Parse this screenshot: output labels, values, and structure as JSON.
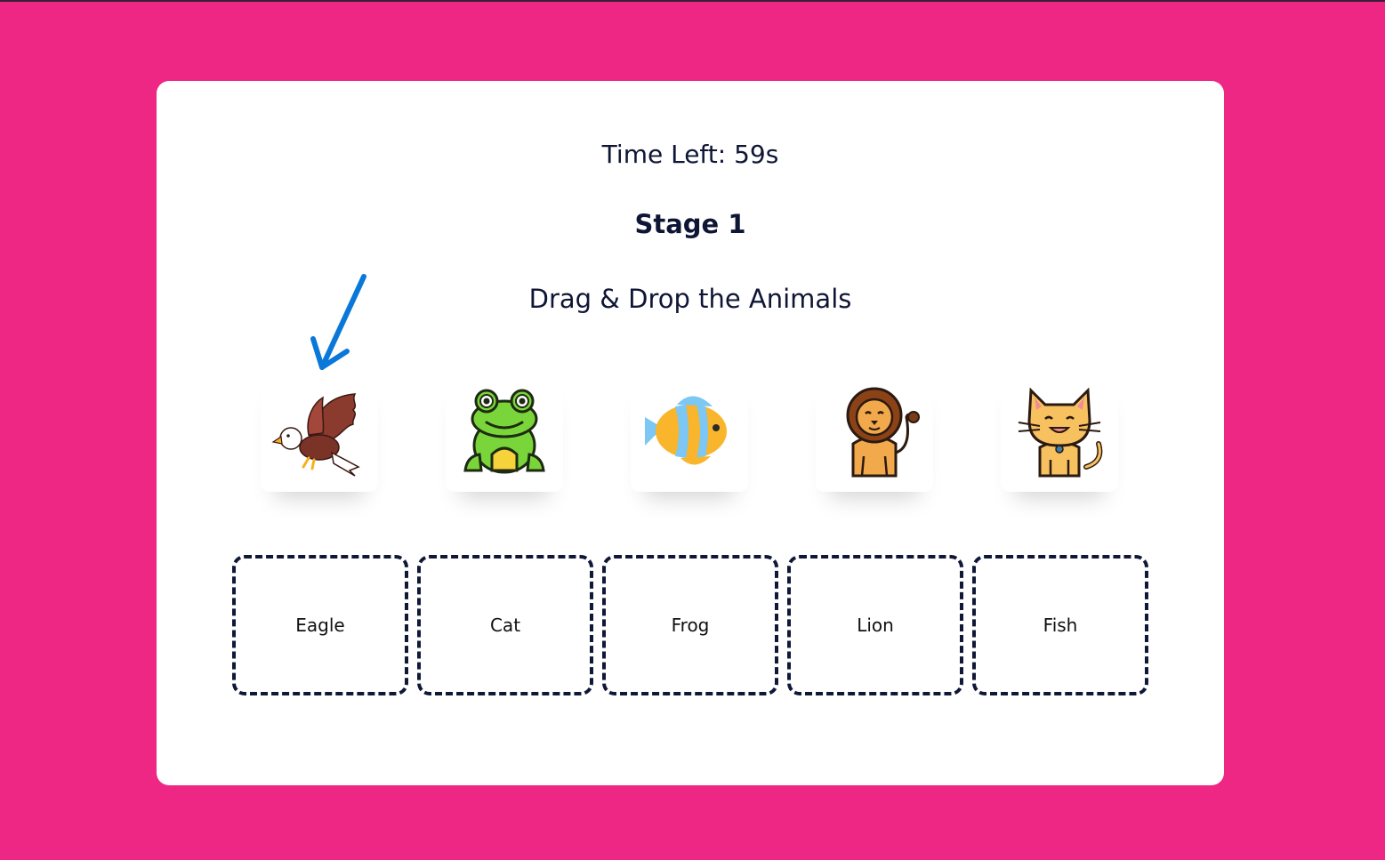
{
  "game": {
    "timer_text": "Time Left: 59s",
    "stage_text": "Stage 1",
    "instruction": "Drag & Drop the Animals"
  },
  "animals": [
    {
      "icon": "eagle-icon"
    },
    {
      "icon": "frog-icon"
    },
    {
      "icon": "fish-icon"
    },
    {
      "icon": "lion-icon"
    },
    {
      "icon": "cat-icon"
    }
  ],
  "drop_zones": [
    {
      "label": "Eagle"
    },
    {
      "label": "Cat"
    },
    {
      "label": "Frog"
    },
    {
      "label": "Lion"
    },
    {
      "label": "Fish"
    }
  ],
  "colors": {
    "background": "#ee2684",
    "card": "#ffffff",
    "text": "#0f1635",
    "pointer_arrow": "#0a78d8"
  }
}
